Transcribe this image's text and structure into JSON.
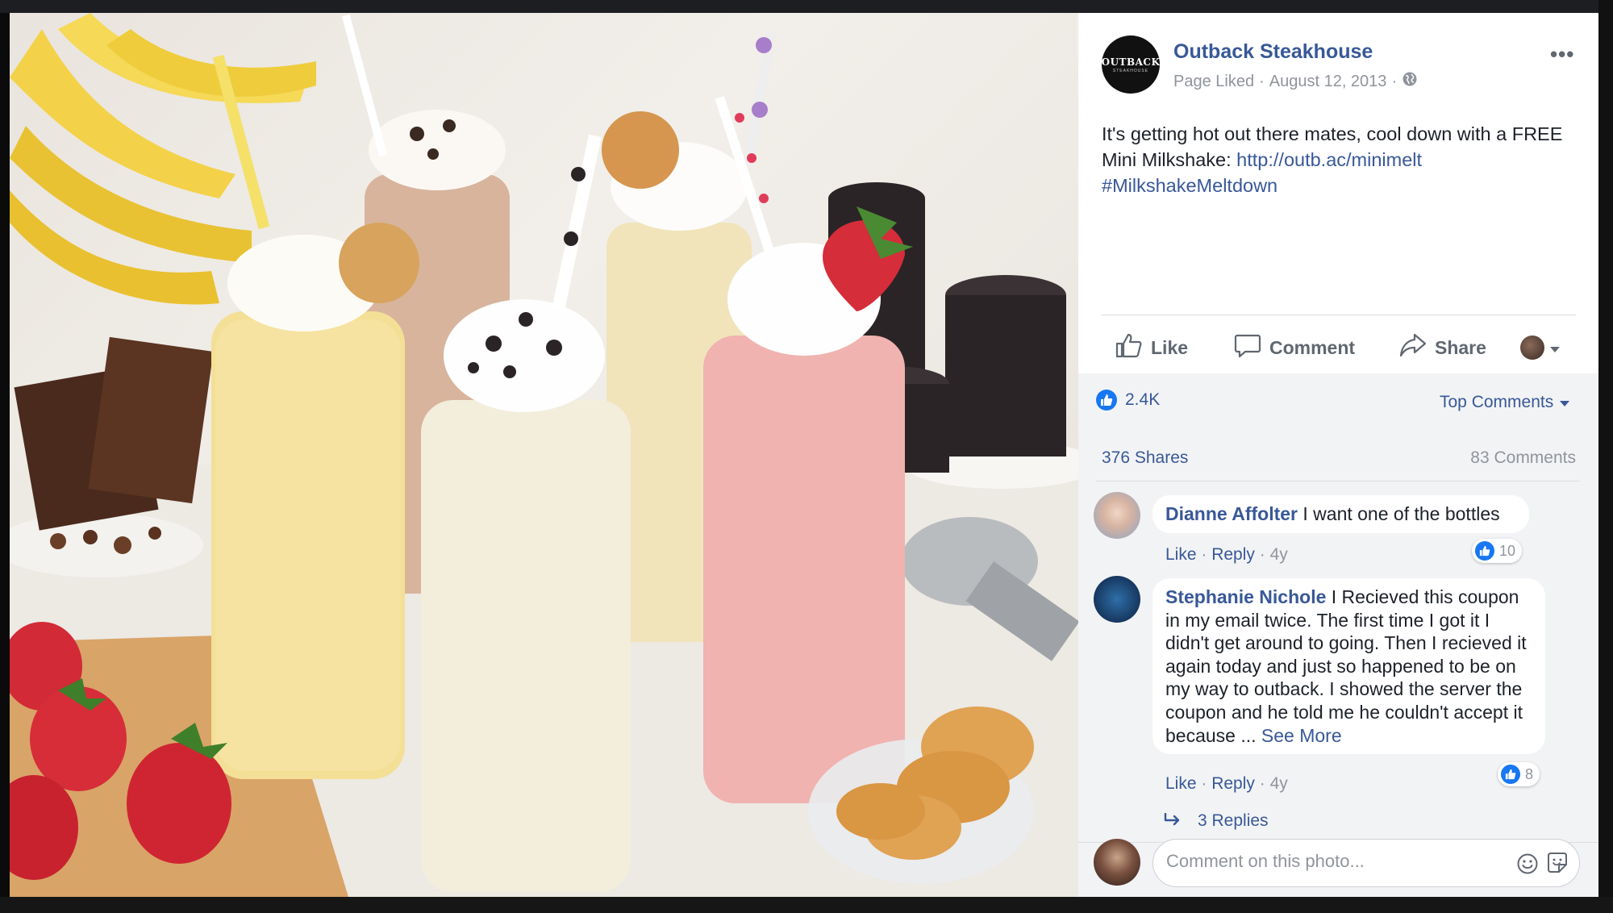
{
  "post": {
    "page_name": "Outback Steakhouse",
    "page_logo_text": "OUTBACK",
    "page_logo_sub": "STEAKHOUSE",
    "meta_liked": "Page Liked",
    "meta_dot": "·",
    "meta_date": "August 12, 2013",
    "text_main": "It's getting hot out there mates, cool down with a FREE Mini Milkshake: ",
    "text_link": "http://outb.ac/minimelt",
    "text_hashtag": "#MilkshakeMeltdown",
    "more_icon": "more-horizontal-icon"
  },
  "actions": {
    "like": "Like",
    "comment": "Comment",
    "share": "Share"
  },
  "stats": {
    "reactions": "2.4K",
    "sort_label": "Top Comments",
    "shares": "376 Shares",
    "comments": "83 Comments"
  },
  "comments": [
    {
      "author": "Dianne Affolter",
      "text": " I want one of the bottles",
      "like": "Like",
      "reply": "Reply",
      "age": "4y",
      "reactions": "10"
    },
    {
      "author": "Stephanie Nichole",
      "text": " I Recieved this coupon in my email twice. The first time I got it I didn't get around to going. Then I recieved it again today and just so happened to be on my way to outback. I showed the server the coupon and he told me he couldn't accept it because ... ",
      "see_more": "See More",
      "like": "Like",
      "reply": "Reply",
      "age": "4y",
      "reactions": "8"
    }
  ],
  "replies_label": "3 Replies",
  "composer": {
    "placeholder": "Comment on this photo..."
  },
  "colors": {
    "link": "#385898",
    "facebook_blue": "#1877f2",
    "muted": "#90949c"
  }
}
